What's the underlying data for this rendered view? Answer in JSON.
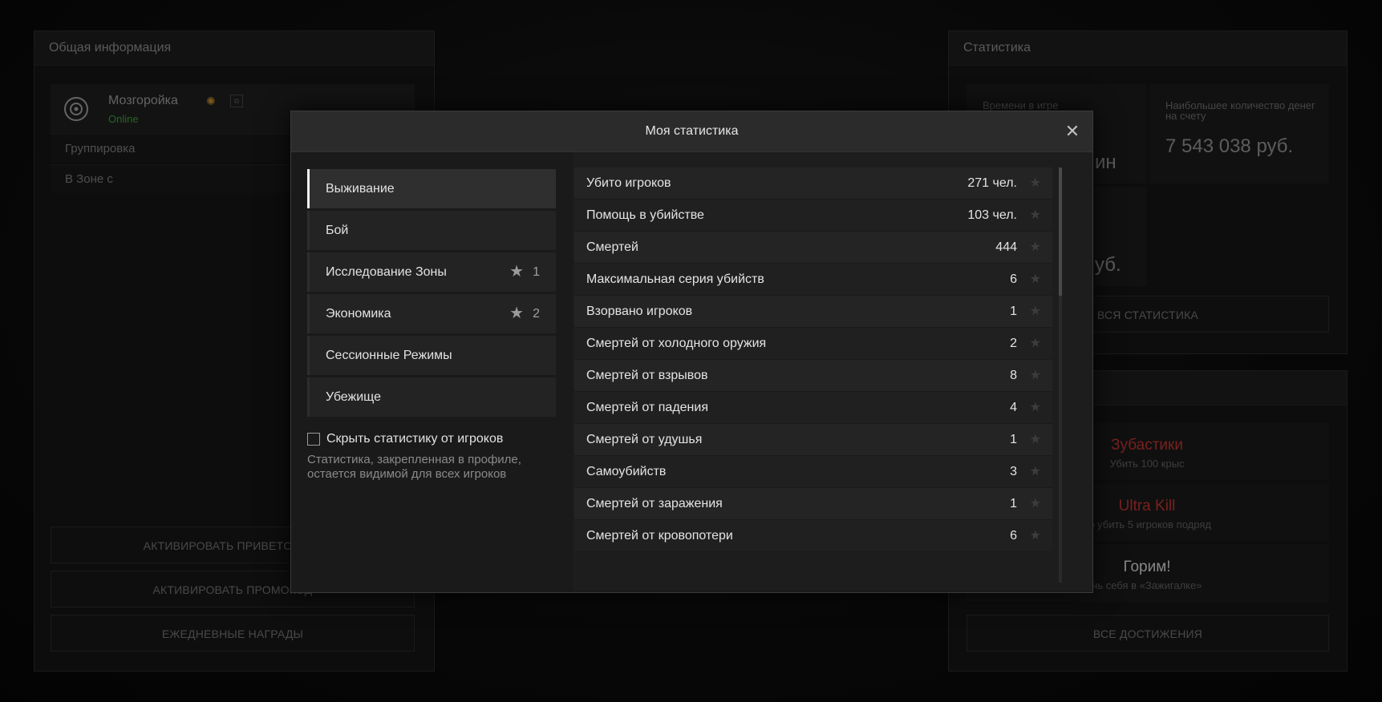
{
  "left_panel": {
    "title": "Общая информация",
    "nickname": "Мозгоройка",
    "status": "Online",
    "group_label": "Группировка",
    "zone_label": "В Зоне с",
    "buttons": [
      "АКТИВИРОВАТЬ ПРИВЕТСТВЕН",
      "АКТИВИРОВАТЬ ПРОМОКОД",
      "ЕЖЕДНЕВНЫЕ НАГРАДЫ"
    ]
  },
  "right_panel": {
    "title": "Статистика",
    "time_label": "Времени в игре",
    "time_value_partial": "ин",
    "money_label": "Наибольшее количество денег на счету",
    "money_value": "7 543 038 руб.",
    "money2_partial": "уб.",
    "all_stats_button": "ВСЯ СТАТИСТИКА",
    "achievements": [
      {
        "title": "Зубастики",
        "desc": "Убить 100 крыс",
        "color": "#b8322e"
      },
      {
        "title": "Ultra Kill",
        "desc": "ро убить 5 игроков подряд",
        "color": "#b8322e"
      },
      {
        "title": "Горим!",
        "desc": "чь себя в «Зажигалке»",
        "color": "#cfcfcf"
      }
    ],
    "all_achievements_button": "ВСЕ ДОСТИЖЕНИЯ"
  },
  "modal": {
    "title": "Моя статистика",
    "categories": [
      {
        "label": "Выживание",
        "active": true,
        "stars": ""
      },
      {
        "label": "Бой",
        "active": false,
        "stars": ""
      },
      {
        "label": "Исследование Зоны",
        "active": false,
        "stars": "1"
      },
      {
        "label": "Экономика",
        "active": false,
        "stars": "2"
      },
      {
        "label": "Сессионные Режимы",
        "active": false,
        "stars": ""
      },
      {
        "label": "Убежище",
        "active": false,
        "stars": ""
      }
    ],
    "hide_checkbox_label": "Скрыть статистику от игроков",
    "hide_note": "Статистика, закрепленная в профиле, остается видимой для всех игроков",
    "stats": [
      {
        "name": "Убито игроков",
        "value": "271 чел."
      },
      {
        "name": "Помощь в убийстве",
        "value": "103 чел."
      },
      {
        "name": "Смертей",
        "value": "444"
      },
      {
        "name": "Максимальная серия убийств",
        "value": "6"
      },
      {
        "name": "Взорвано игроков",
        "value": "1"
      },
      {
        "name": "Смертей от холодного оружия",
        "value": "2"
      },
      {
        "name": "Смертей от взрывов",
        "value": "8"
      },
      {
        "name": "Смертей от падения",
        "value": "4"
      },
      {
        "name": "Смертей от удушья",
        "value": "1"
      },
      {
        "name": "Самоубийств",
        "value": "3"
      },
      {
        "name": "Смертей от заражения",
        "value": "1"
      },
      {
        "name": "Смертей от кровопотери",
        "value": "6"
      }
    ]
  },
  "icons": {
    "close": "close-icon",
    "star": "star-icon",
    "shield": "shield-icon",
    "sun": "sun-badge-icon"
  }
}
